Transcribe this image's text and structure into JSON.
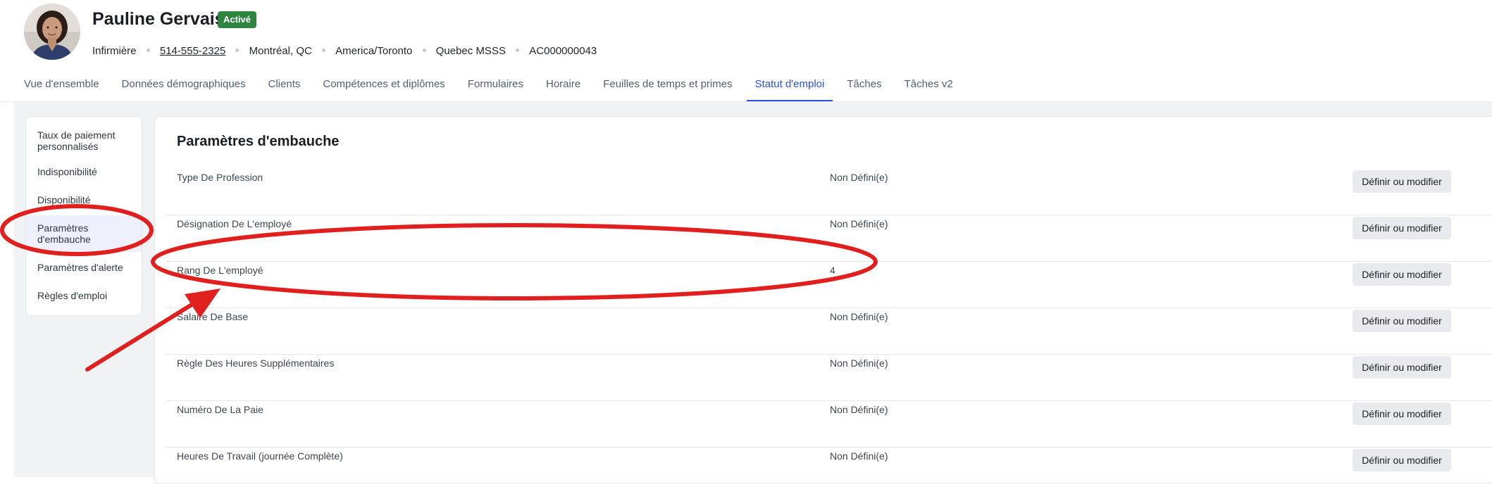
{
  "profile": {
    "name": "Pauline Gervais",
    "status_badge": "Activé",
    "role": "Infirmière",
    "phone": "514-555-2325",
    "location": "Montréal, QC",
    "timezone": "America/Toronto",
    "organization": "Quebec MSSS",
    "account_id": "AC000000043"
  },
  "tabs": [
    {
      "label": "Vue d'ensemble",
      "active": false
    },
    {
      "label": "Données démographiques",
      "active": false
    },
    {
      "label": "Clients",
      "active": false
    },
    {
      "label": "Compétences et diplômes",
      "active": false
    },
    {
      "label": "Formulaires",
      "active": false
    },
    {
      "label": "Horaire",
      "active": false
    },
    {
      "label": "Feuilles de temps et primes",
      "active": false
    },
    {
      "label": "Statut d'emploi",
      "active": true
    },
    {
      "label": "Tâches",
      "active": false
    },
    {
      "label": "Tâches v2",
      "active": false
    }
  ],
  "sidebar": {
    "items": [
      {
        "label": "Taux de paiement personnalisés",
        "active": false
      },
      {
        "label": "Indisponibilité",
        "active": false
      },
      {
        "label": "Disponibilité",
        "active": false
      },
      {
        "label": "Paramètres d'embauche",
        "active": true
      },
      {
        "label": "Paramètres d'alerte",
        "active": false
      },
      {
        "label": "Règles d'emploi",
        "active": false
      }
    ]
  },
  "main": {
    "title": "Paramètres d'embauche",
    "rows": [
      {
        "field": "Type De Profession",
        "value": "Non Défini(e)",
        "button": "Définir ou modifier"
      },
      {
        "field": "Désignation De L'employé",
        "value": "Non Défini(e)",
        "button": "Définir ou modifier"
      },
      {
        "field": "Rang De L'employé",
        "value": "4",
        "button": "Définir ou modifier"
      },
      {
        "field": "Salaire De Base",
        "value": "Non Défini(e)",
        "button": "Définir ou modifier"
      },
      {
        "field": "Règle Des Heures Supplémentaires",
        "value": "Non Défini(e)",
        "button": "Définir ou modifier"
      },
      {
        "field": "Numéro De La Paie",
        "value": "Non Défini(e)",
        "button": "Définir ou modifier"
      },
      {
        "field": "Heures De Travail (journée Complète)",
        "value": "Non Défini(e)",
        "button": "Définir ou modifier"
      }
    ]
  },
  "colors": {
    "accent": "#2a4fd6",
    "badge_green": "#2e8540",
    "annotation_red": "#e0201f"
  },
  "icons": {
    "avatar": "user-photo"
  }
}
